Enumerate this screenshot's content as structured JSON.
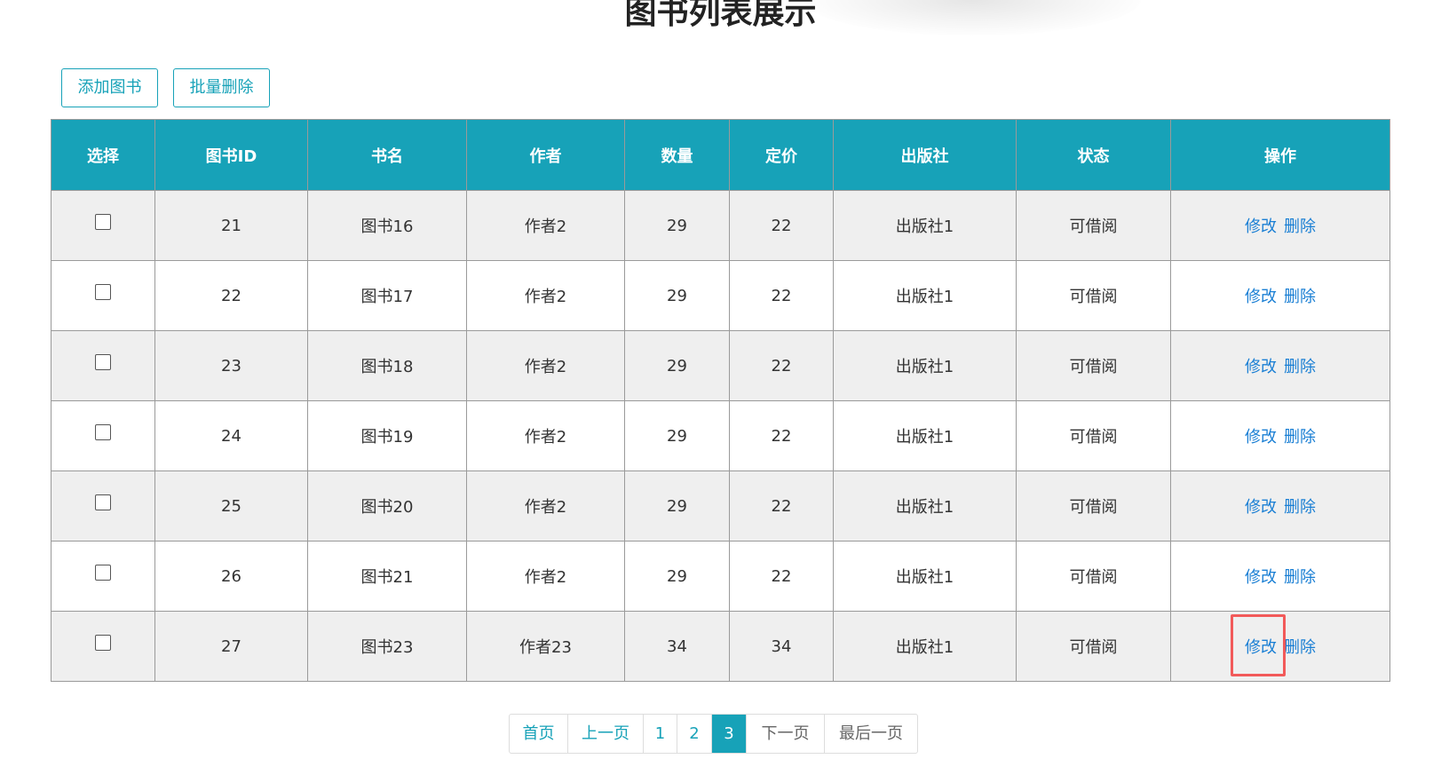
{
  "title": "图书列表展示",
  "toolbar": {
    "add_label": "添加图书",
    "batch_delete_label": "批量删除"
  },
  "table": {
    "headers": [
      "选择",
      "图书ID",
      "书名",
      "作者",
      "数量",
      "定价",
      "出版社",
      "状态",
      "操作"
    ],
    "rows": [
      {
        "id": "21",
        "name": "图书16",
        "author": "作者2",
        "count": "29",
        "price": "22",
        "publisher": "出版社1",
        "status": "可借阅"
      },
      {
        "id": "22",
        "name": "图书17",
        "author": "作者2",
        "count": "29",
        "price": "22",
        "publisher": "出版社1",
        "status": "可借阅"
      },
      {
        "id": "23",
        "name": "图书18",
        "author": "作者2",
        "count": "29",
        "price": "22",
        "publisher": "出版社1",
        "status": "可借阅"
      },
      {
        "id": "24",
        "name": "图书19",
        "author": "作者2",
        "count": "29",
        "price": "22",
        "publisher": "出版社1",
        "status": "可借阅"
      },
      {
        "id": "25",
        "name": "图书20",
        "author": "作者2",
        "count": "29",
        "price": "22",
        "publisher": "出版社1",
        "status": "可借阅"
      },
      {
        "id": "26",
        "name": "图书21",
        "author": "作者2",
        "count": "29",
        "price": "22",
        "publisher": "出版社1",
        "status": "可借阅"
      },
      {
        "id": "27",
        "name": "图书23",
        "author": "作者23",
        "count": "34",
        "price": "34",
        "publisher": "出版社1",
        "status": "可借阅"
      }
    ],
    "edit_label": "修改",
    "delete_label": "删除"
  },
  "pagination": {
    "first": "首页",
    "prev": "上一页",
    "pages": [
      "1",
      "2",
      "3"
    ],
    "current": "3",
    "next": "下一页",
    "last": "最后一页"
  },
  "colors": {
    "accent": "#17a2b8",
    "link": "#1a7fd4",
    "highlight": "#f25a5a"
  }
}
